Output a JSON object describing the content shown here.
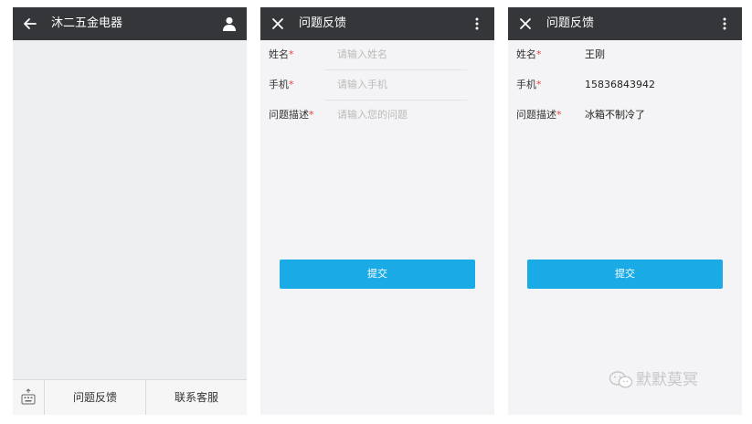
{
  "screen_home": {
    "title": "沐二五金电器",
    "back_icon": "arrow-left-icon",
    "profile_icon": "person-icon",
    "bottom_menu": {
      "keyboard_icon": "keyboard-icon",
      "items": [
        "问题反馈",
        "联系客服"
      ]
    }
  },
  "screen_form_empty": {
    "title": "问题反馈",
    "close_icon": "close-icon",
    "more_icon": "more-vertical-icon",
    "fields": [
      {
        "label": "姓名",
        "required_mark": "*",
        "placeholder": "请输入姓名"
      },
      {
        "label": "手机",
        "required_mark": "*",
        "placeholder": "请输入手机"
      },
      {
        "label": "问题描述",
        "required_mark": "*",
        "placeholder": "请输入您的问题"
      }
    ],
    "submit_label": "提交"
  },
  "screen_form_filled": {
    "title": "问题反馈",
    "close_icon": "close-icon",
    "more_icon": "more-vertical-icon",
    "fields": [
      {
        "label": "姓名",
        "required_mark": "*",
        "value": "王刚"
      },
      {
        "label": "手机",
        "required_mark": "*",
        "value": "15836843942"
      },
      {
        "label": "问题描述",
        "required_mark": "*",
        "value": "冰箱不制冷了"
      }
    ],
    "submit_label": "提交",
    "watermark": "默默莫冥",
    "watermark_icon": "wechat-icon"
  },
  "colors": {
    "topbar": "#343639",
    "submit": "#1aabe6",
    "required": "#e64340",
    "background": "#f4f4f6"
  }
}
